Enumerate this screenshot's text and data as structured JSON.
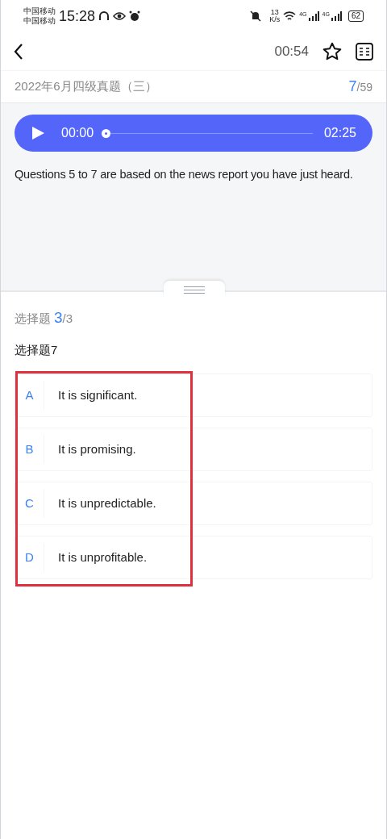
{
  "status_bar": {
    "carriers": [
      "中国移动",
      "中国移动"
    ],
    "time": "15:28",
    "speed_value": "13",
    "speed_unit": "K/s",
    "networks": [
      "4G",
      "4G"
    ],
    "battery": "62"
  },
  "header": {
    "timer": "00:54",
    "starred": false
  },
  "exam": {
    "title": "2022年6月四级真题（三）",
    "current": "7",
    "total": "/59"
  },
  "player": {
    "playing": false,
    "elapsed": "00:00",
    "duration": "02:25"
  },
  "instructions": "Questions 5 to 7 are based on the news report you have just heard.",
  "section": {
    "label": "选择题",
    "current": "3",
    "total": "/3"
  },
  "question": "选择题7",
  "options_highlighted": true,
  "options": [
    {
      "letter": "A",
      "text": "It is significant.",
      "selected": false
    },
    {
      "letter": "B",
      "text": "It is promising.",
      "selected": false
    },
    {
      "letter": "C",
      "text": "It is unpredictable.",
      "selected": false
    },
    {
      "letter": "D",
      "text": "It is unprofitable.",
      "selected": false
    }
  ]
}
